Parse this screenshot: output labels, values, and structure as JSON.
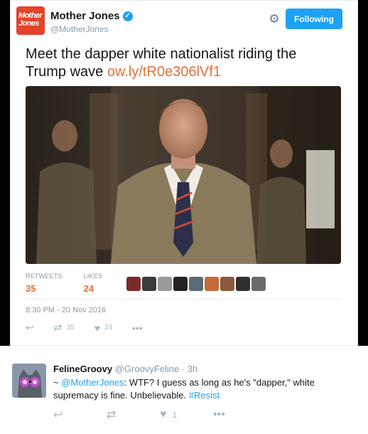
{
  "tweet": {
    "author_name": "Mother Jones",
    "author_handle": "@MotherJones",
    "logo_line1": "Mother",
    "logo_line2": "Jones",
    "follow_label": "Following",
    "text": "Meet the dapper white nationalist riding the Trump wave ",
    "link": "ow.ly/tR0e306lVf1",
    "retweets_label": "RETWEETS",
    "retweets_count": "35",
    "likes_label": "LIKES",
    "likes_count": "24",
    "timestamp": "8:30 PM - 20 Nov 2016",
    "action_retweet_count": "35",
    "action_like_count": "24",
    "liker_colors": [
      "#7a2b2b",
      "#3b3b3b",
      "#9a9a9a",
      "#222222",
      "#5a6b7a",
      "#c76a3a",
      "#8a5a3a",
      "#303030",
      "#6a6a6a"
    ]
  },
  "reply": {
    "name": "FelineGroovy",
    "handle": "@GroovyFeline",
    "time": "· 3h",
    "prefix": "~ ",
    "mention": "@MotherJones",
    "body": ": WTF? I guess as long as he's \"dapper,\" white supremacy is fine. Unbelievable. ",
    "hashtag": "#Resist",
    "like_count": "1"
  },
  "colors": {
    "accent": "#e0723b",
    "twitter_blue": "#1da1f2",
    "brand_red": "#e3442b"
  }
}
